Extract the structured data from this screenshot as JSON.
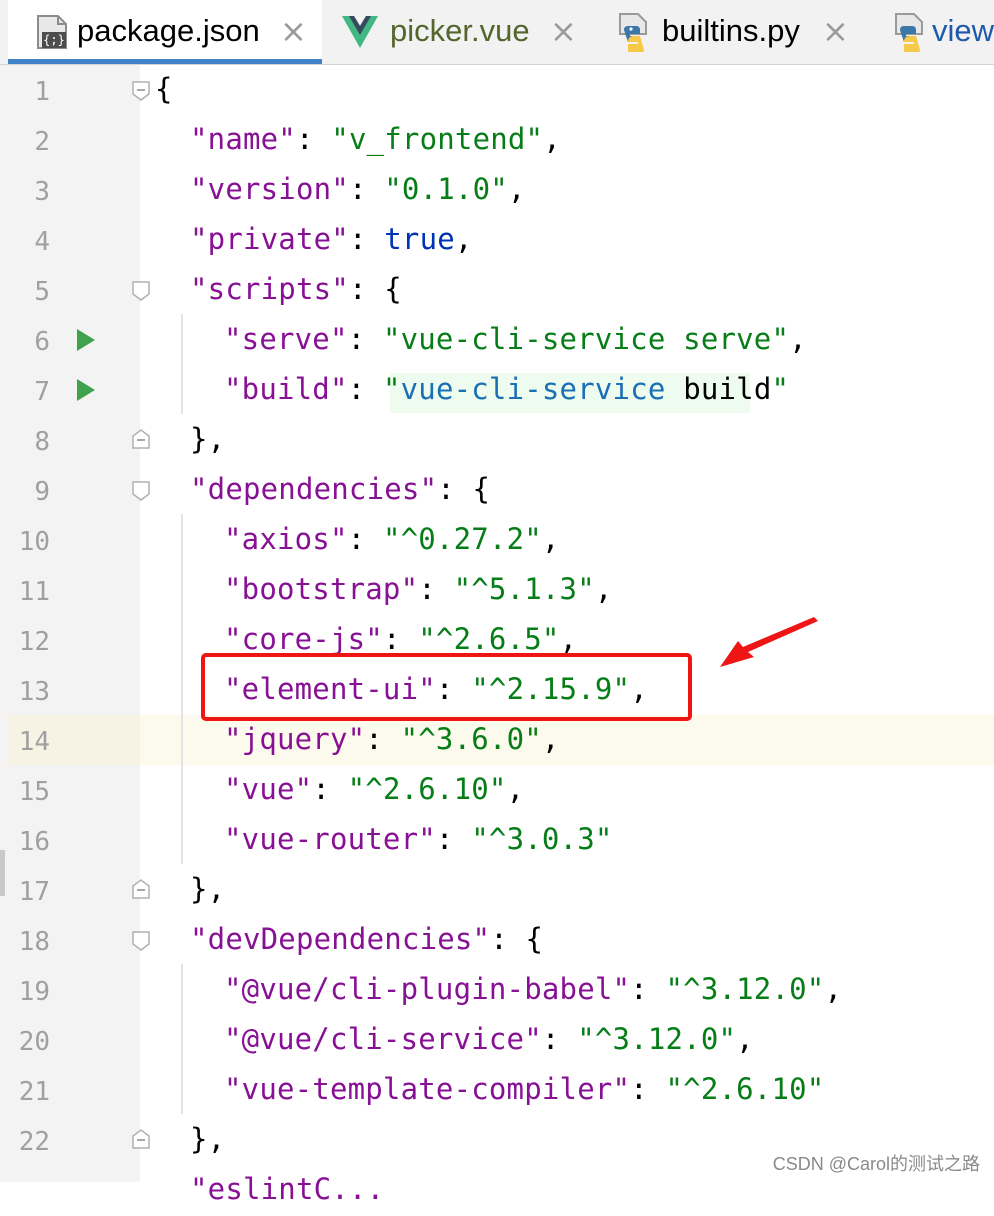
{
  "tabs": [
    {
      "label": "package.json",
      "icon": "json-file-icon",
      "active": true
    },
    {
      "label": "picker.vue",
      "icon": "vue-file-icon",
      "active": false
    },
    {
      "label": "builtins.py",
      "icon": "python-file-icon",
      "active": false
    },
    {
      "label": "view",
      "icon": "python-file-icon",
      "active": false
    }
  ],
  "tab_close_glyph": "×",
  "editor": {
    "lines": [
      {
        "n": "1"
      },
      {
        "n": "2"
      },
      {
        "n": "3"
      },
      {
        "n": "4"
      },
      {
        "n": "5"
      },
      {
        "n": "6"
      },
      {
        "n": "7"
      },
      {
        "n": "8"
      },
      {
        "n": "9"
      },
      {
        "n": "10"
      },
      {
        "n": "11"
      },
      {
        "n": "12"
      },
      {
        "n": "13"
      },
      {
        "n": "14"
      },
      {
        "n": "15"
      },
      {
        "n": "16"
      },
      {
        "n": "17"
      },
      {
        "n": "18"
      },
      {
        "n": "19"
      },
      {
        "n": "20"
      },
      {
        "n": "21"
      },
      {
        "n": "22"
      }
    ],
    "code": {
      "l1": "{",
      "l2_key": "\"name\"",
      "l2_val": "\"v_frontend\"",
      "l3_key": "\"version\"",
      "l3_val": "\"0.1.0\"",
      "l4_key": "\"private\"",
      "l4_val": "true",
      "l5_key": "\"scripts\"",
      "l6_key": "\"serve\"",
      "l6_val": "\"vue-cli-service serve\"",
      "l7_key": "\"build\"",
      "l7_val_q1": "\"",
      "l7_val_a": "vue-cli-service",
      "l7_val_b": " build",
      "l7_val_q2": "\"",
      "l8": "},",
      "l9_key": "\"dependencies\"",
      "l10_key": "\"axios\"",
      "l10_val": "\"^0.27.2\"",
      "l11_key": "\"bootstrap\"",
      "l11_val": "\"^5.1.3\"",
      "l12_key": "\"core-js\"",
      "l12_val": "\"^2.6.5\"",
      "l13_key": "\"element-ui\"",
      "l13_val": "\"^2.15.9\"",
      "l14_key": "\"jquery\"",
      "l14_val": "\"^3.6.0\"",
      "l15_key": "\"vue\"",
      "l15_val": "\"^2.6.10\"",
      "l16_key": "\"vue-router\"",
      "l16_val": "\"^3.0.3\"",
      "l17": "},",
      "l18_key": "\"devDependencies\"",
      "l19_key": "\"@vue/cli-plugin-babel\"",
      "l19_val": "\"^3.12.0\"",
      "l20_key": "\"@vue/cli-service\"",
      "l20_val": "\"^3.12.0\"",
      "l21_key": "\"vue-template-compiler\"",
      "l21_val": "\"^2.6.10\"",
      "l22": "},",
      "l23_partial": "\"eslintC..."
    }
  },
  "watermark": "CSDN @Carol的测试之路",
  "colors": {
    "key": "#871094",
    "string": "#067d17",
    "boolean": "#0033b3",
    "annotation": "#ef1515",
    "tab_underline": "#4083c9",
    "run": "#3fa34d"
  }
}
